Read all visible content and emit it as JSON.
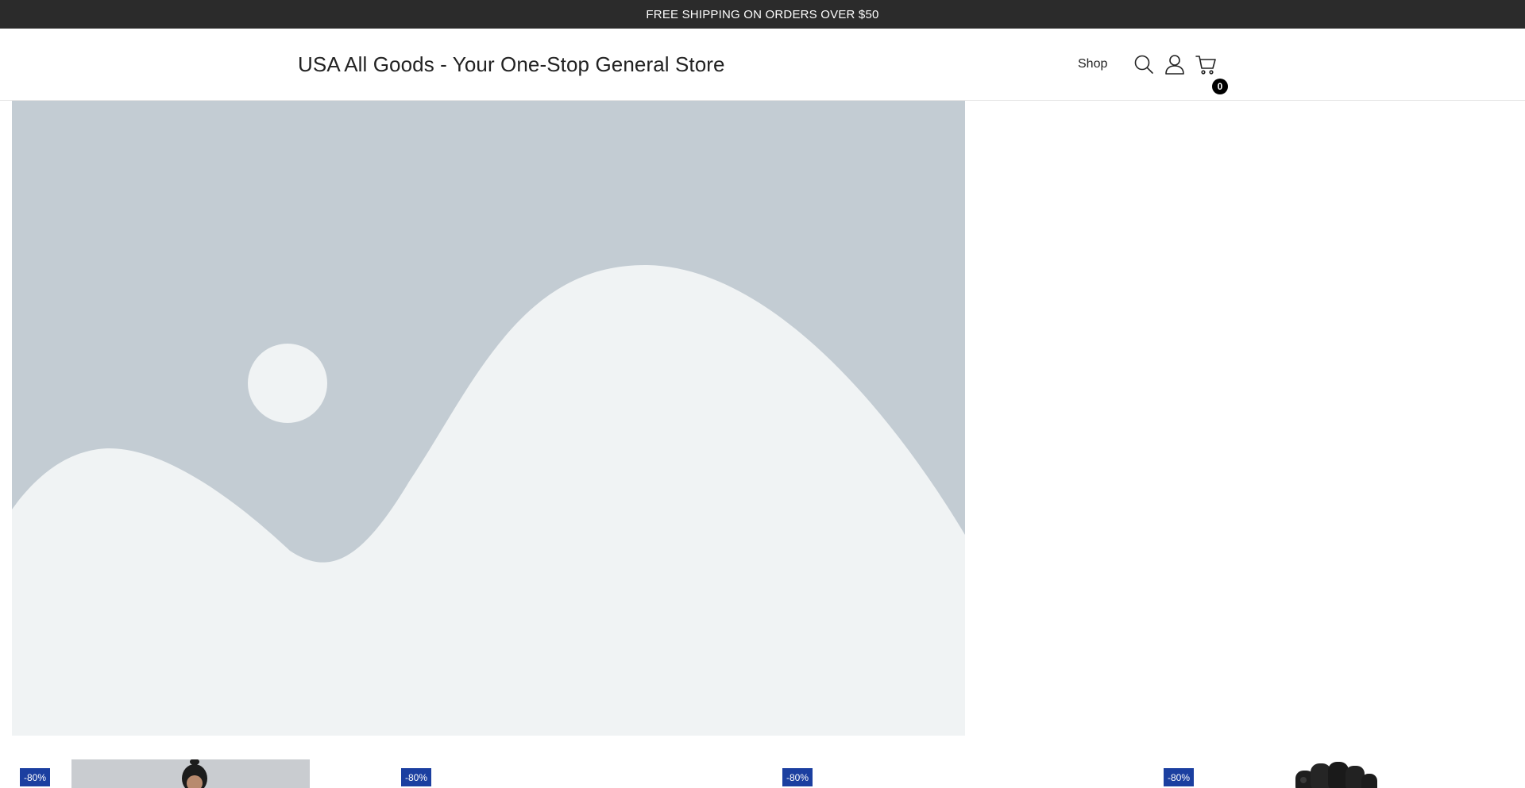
{
  "announcement": {
    "text": "FREE SHIPPING ON ORDERS OVER $50"
  },
  "header": {
    "site_title": "USA All Goods - Your One-Stop General Store",
    "nav": [
      {
        "label": "Shop"
      }
    ],
    "icons": {
      "search": "search-icon",
      "account": "user-icon",
      "cart": "cart-icon"
    },
    "cart_count": "0"
  },
  "hero": {
    "image": "placeholder-landscape-image",
    "colors": {
      "sky": "#c3ccd3",
      "hills": "#f0f3f4"
    }
  },
  "products": [
    {
      "badge": "-80%",
      "image": "jacket-photo"
    },
    {
      "badge": "-80%",
      "image": "blank"
    },
    {
      "badge": "-80%",
      "image": "blank"
    },
    {
      "badge": "-80%",
      "image": "gloves-photo"
    }
  ],
  "colors": {
    "announcement_bg": "#2b2b2b",
    "badge_bg": "#1b3fa0",
    "cart_badge_bg": "#000000"
  }
}
